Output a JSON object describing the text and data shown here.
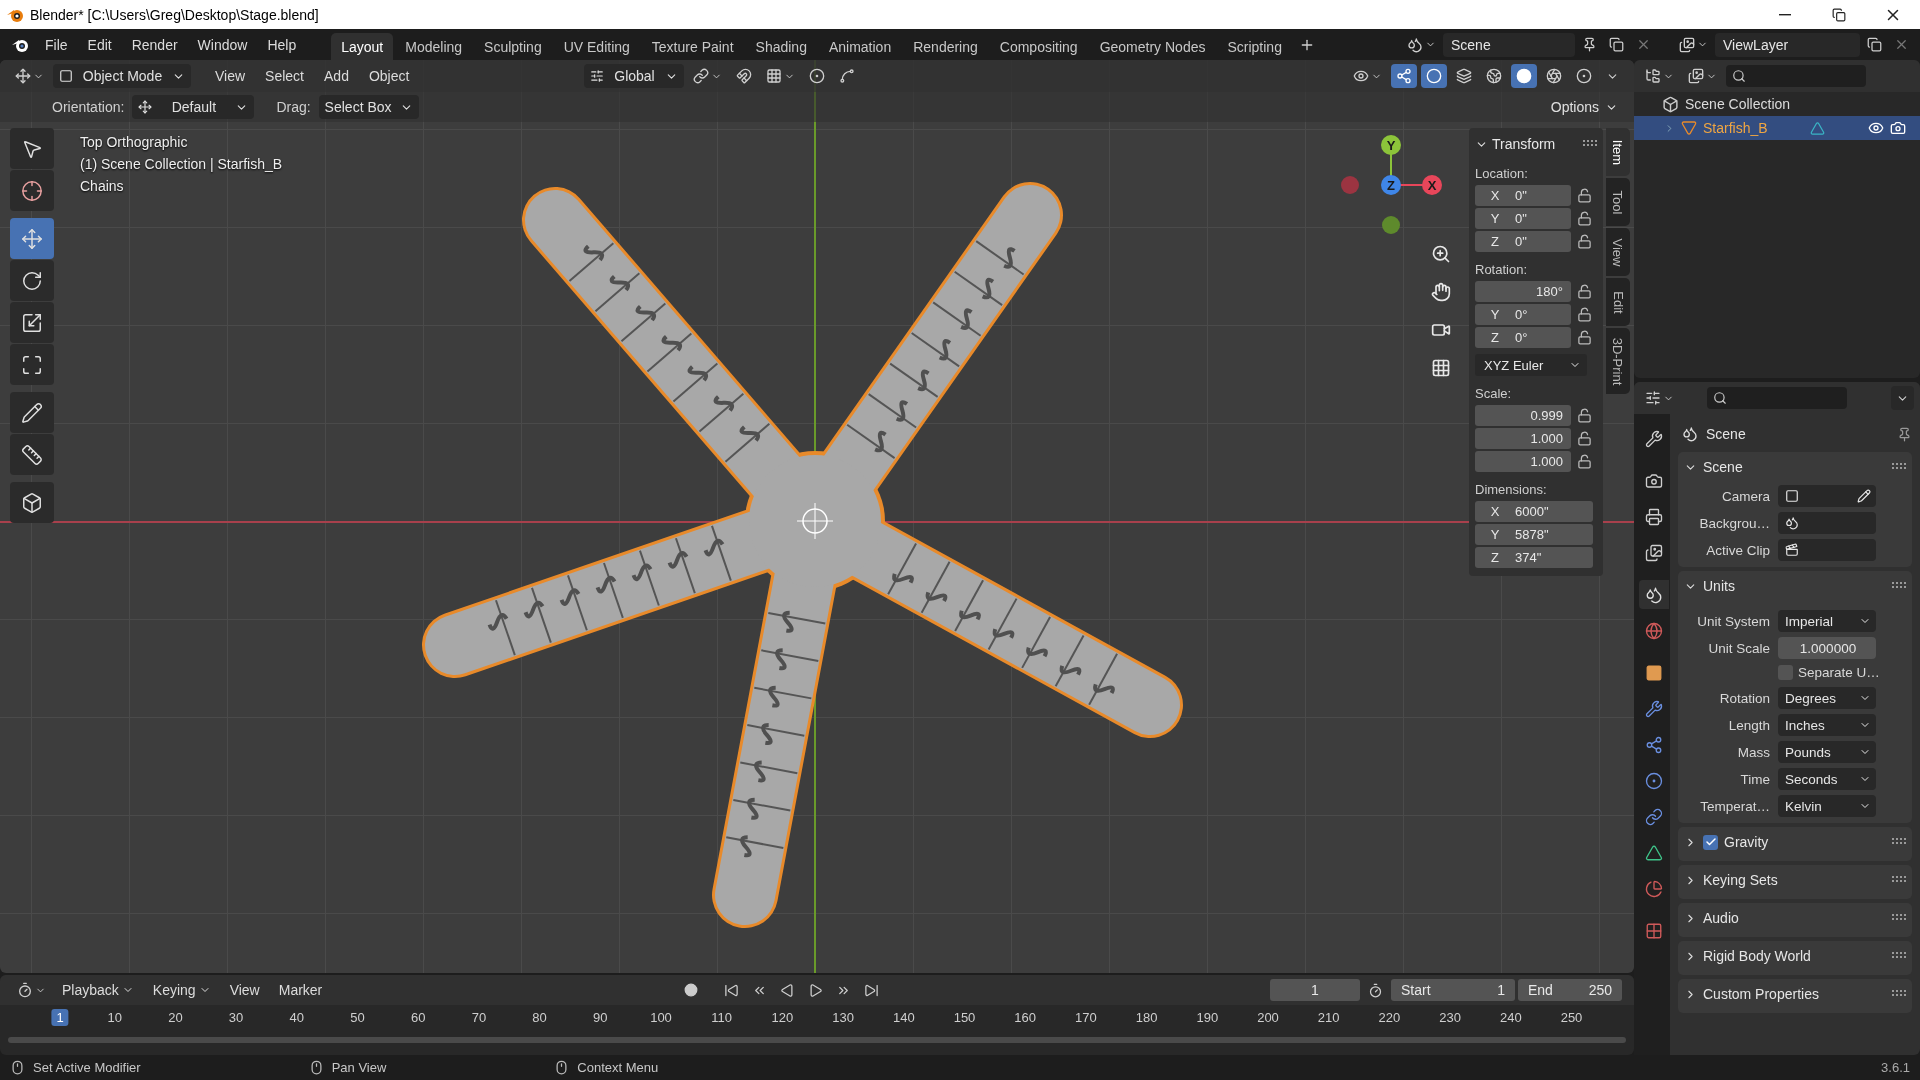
{
  "title_bar": {
    "title": "Blender* [C:\\Users\\Greg\\Desktop\\Stage.blend]"
  },
  "menus": [
    "File",
    "Edit",
    "Render",
    "Window",
    "Help"
  ],
  "workspaces": [
    {
      "label": "Layout",
      "selected": true
    },
    {
      "label": "Modeling",
      "selected": false
    },
    {
      "label": "Sculpting",
      "selected": false
    },
    {
      "label": "UV Editing",
      "selected": false
    },
    {
      "label": "Texture Paint",
      "selected": false
    },
    {
      "label": "Shading",
      "selected": false
    },
    {
      "label": "Animation",
      "selected": false
    },
    {
      "label": "Rendering",
      "selected": false
    },
    {
      "label": "Compositing",
      "selected": false
    },
    {
      "label": "Geometry Nodes",
      "selected": false
    },
    {
      "label": "Scripting",
      "selected": false
    }
  ],
  "scene": {
    "name": "Scene"
  },
  "view_layer": {
    "name": "ViewLayer"
  },
  "viewport_header": {
    "mode": "Object Mode",
    "menus": [
      "View",
      "Select",
      "Add",
      "Object"
    ],
    "orientation": "Global",
    "shading": [
      {
        "kind": "wireframe",
        "selected": false
      },
      {
        "kind": "solid",
        "selected": true
      },
      {
        "kind": "material",
        "selected": false
      },
      {
        "kind": "rendered",
        "selected": false
      }
    ]
  },
  "tool_settings": {
    "orientation_label": "Orientation:",
    "orientation": "Default",
    "drag_label": "Drag:",
    "drag": "Select Box",
    "options": "Options"
  },
  "tools": [
    {
      "kind": "select",
      "selected": false
    },
    {
      "kind": "cursor",
      "selected": false
    },
    {
      "kind": "move",
      "selected": true
    },
    {
      "kind": "rotate",
      "selected": false
    },
    {
      "kind": "scale",
      "selected": false
    },
    {
      "kind": "transform",
      "selected": false
    },
    {
      "kind": "annotate",
      "selected": false
    },
    {
      "kind": "measure",
      "selected": false
    },
    {
      "kind": "add-cube",
      "selected": false
    }
  ],
  "viewport": {
    "overlay_lines": [
      "Top Orthographic",
      "(1) Scene Collection | Starfish_B",
      "Chains"
    ],
    "gizmo_axes": [
      "Y",
      "Z",
      "X"
    ]
  },
  "transform": {
    "title": "Transform",
    "groups": [
      {
        "label": "Location:",
        "fields": [
          {
            "axis": "X",
            "value": "0\"",
            "locked": false
          },
          {
            "axis": "Y",
            "value": "0\"",
            "locked": false
          },
          {
            "axis": "Z",
            "value": "0\"",
            "locked": false
          }
        ]
      },
      {
        "label": "Rotation:",
        "fields": [
          {
            "value": "180°",
            "locked": false
          },
          {
            "axis": "Y",
            "value": "0°",
            "locked": false
          },
          {
            "axis": "Z",
            "value": "0°",
            "locked": false
          }
        ],
        "mode": "XYZ Euler"
      },
      {
        "label": "Scale:",
        "fields": [
          {
            "value": "0.999",
            "locked": false
          },
          {
            "value": "1.000",
            "locked": false
          },
          {
            "value": "1.000",
            "locked": false
          }
        ]
      },
      {
        "label": "Dimensions:",
        "fields": [
          {
            "axis": "X",
            "value": "6000\""
          },
          {
            "axis": "Y",
            "value": "5878\""
          },
          {
            "axis": "Z",
            "value": "374\""
          }
        ]
      }
    ]
  },
  "sidebar_tabs": [
    {
      "label": "Item",
      "selected": true
    },
    {
      "label": "Tool",
      "selected": false
    },
    {
      "label": "View",
      "selected": false
    },
    {
      "label": "Edit",
      "selected": false
    },
    {
      "label": "3D-Print",
      "selected": false
    }
  ],
  "outliner": {
    "root": "Scene Collection",
    "items": [
      {
        "label": "Starfish_B",
        "selected": true
      }
    ]
  },
  "properties": {
    "tabs": [
      {
        "kind": "tool",
        "selected": false
      },
      {
        "kind": "render",
        "selected": false
      },
      {
        "kind": "output",
        "selected": false
      },
      {
        "kind": "view-layer",
        "selected": false
      },
      {
        "kind": "scene",
        "selected": true
      },
      {
        "kind": "world",
        "selected": false
      },
      {
        "kind": "object",
        "selected": false
      },
      {
        "kind": "modifier",
        "selected": false
      },
      {
        "kind": "particles",
        "selected": false
      },
      {
        "kind": "physics",
        "selected": false
      },
      {
        "kind": "constraints",
        "selected": false
      },
      {
        "kind": "data",
        "selected": false
      },
      {
        "kind": "material",
        "selected": false
      },
      {
        "kind": "texture",
        "selected": false
      }
    ],
    "header": "Scene",
    "panels": [
      {
        "title": "Scene",
        "expanded": true,
        "rows": [
          {
            "label": "Camera",
            "kind": "camera"
          },
          {
            "label": "Backgrou…",
            "kind": "scene"
          },
          {
            "label": "Active Clip",
            "kind": "clip"
          }
        ]
      },
      {
        "title": "Units",
        "expanded": true,
        "rows": [
          {
            "label": "Unit System",
            "kind": "dropdown",
            "value": "Imperial"
          },
          {
            "label": "Unit Scale",
            "kind": "number",
            "value": "1.000000"
          },
          {
            "label": "Separate U…",
            "kind": "checkbox",
            "checked": false
          },
          {
            "label": "Rotation",
            "kind": "dropdown",
            "value": "Degrees"
          },
          {
            "label": "Length",
            "kind": "dropdown",
            "value": "Inches"
          },
          {
            "label": "Mass",
            "kind": "dropdown",
            "value": "Pounds"
          },
          {
            "label": "Time",
            "kind": "dropdown",
            "value": "Seconds"
          },
          {
            "label": "Temperat…",
            "kind": "dropdown",
            "value": "Kelvin"
          }
        ]
      },
      {
        "title": "Gravity",
        "expanded": false,
        "checked": true
      },
      {
        "title": "Keying Sets",
        "expanded": false
      },
      {
        "title": "Audio",
        "expanded": false
      },
      {
        "title": "Rigid Body World",
        "expanded": false
      },
      {
        "title": "Custom Properties",
        "expanded": false
      }
    ]
  },
  "timeline": {
    "menus": [
      "Playback",
      "Keying",
      "View",
      "Marker"
    ],
    "current_frame": "1",
    "start_label": "Start",
    "start": "1",
    "end_label": "End",
    "end": "250",
    "ruler": [
      {
        "label": "1",
        "selected": true
      },
      {
        "label": "10",
        "selected": false
      },
      {
        "label": "20",
        "selected": false
      },
      {
        "label": "30",
        "selected": false
      },
      {
        "label": "40",
        "selected": false
      },
      {
        "label": "50",
        "selected": false
      },
      {
        "label": "60",
        "selected": false
      },
      {
        "label": "70",
        "selected": false
      },
      {
        "label": "80",
        "selected": false
      },
      {
        "label": "90",
        "selected": false
      },
      {
        "label": "100",
        "selected": false
      },
      {
        "label": "110",
        "selected": false
      },
      {
        "label": "120",
        "selected": false
      },
      {
        "label": "130",
        "selected": false
      },
      {
        "label": "140",
        "selected": false
      },
      {
        "label": "150",
        "selected": false
      },
      {
        "label": "160",
        "selected": false
      },
      {
        "label": "170",
        "selected": false
      },
      {
        "label": "180",
        "selected": false
      },
      {
        "label": "190",
        "selected": false
      },
      {
        "label": "200",
        "selected": false
      },
      {
        "label": "210",
        "selected": false
      },
      {
        "label": "220",
        "selected": false
      },
      {
        "label": "230",
        "selected": false
      },
      {
        "label": "240",
        "selected": false
      },
      {
        "label": "250",
        "selected": false
      }
    ]
  },
  "status_bar": {
    "hints": [
      "Set Active Modifier",
      "Pan View",
      "Context Menu"
    ],
    "version": "3.6.1"
  }
}
